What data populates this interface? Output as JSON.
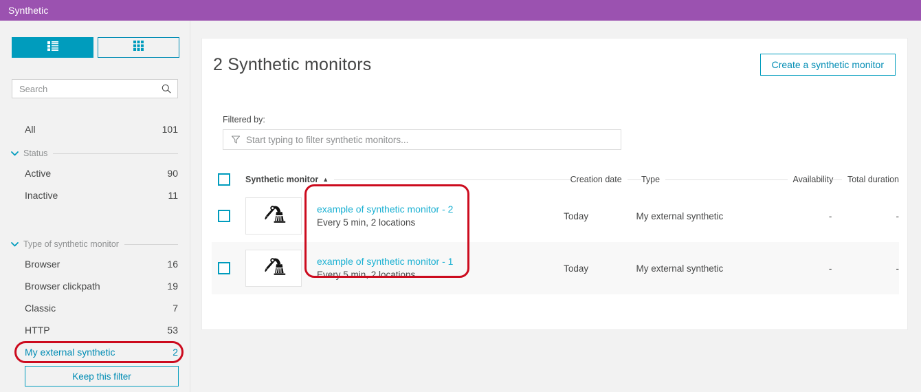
{
  "window": {
    "title": "Synthetic"
  },
  "sidebar": {
    "view_toggle": [
      {
        "name": "list-view",
        "icon": "list-icon",
        "active": true
      },
      {
        "name": "grid-view",
        "icon": "grid-icon",
        "active": false
      }
    ],
    "search": {
      "value": "",
      "placeholder": "Search",
      "icon": "search-icon"
    },
    "all": {
      "label": "All",
      "count": "101"
    },
    "groups": [
      {
        "label": "Status",
        "chevron": "chevron-down-icon",
        "items": [
          {
            "label": "Active",
            "count": "90",
            "selected": false
          },
          {
            "label": "Inactive",
            "count": "11",
            "selected": false
          }
        ]
      },
      {
        "label": "Type of synthetic monitor",
        "chevron": "chevron-down-icon",
        "items": [
          {
            "label": "Browser",
            "count": "16",
            "selected": false
          },
          {
            "label": "Browser clickpath",
            "count": "19",
            "selected": false
          },
          {
            "label": "Classic",
            "count": "7",
            "selected": false
          },
          {
            "label": "HTTP",
            "count": "53",
            "selected": false
          },
          {
            "label": "My external synthetic",
            "count": "2",
            "selected": true
          }
        ]
      }
    ],
    "keep_filter_label": "Keep this filter"
  },
  "main": {
    "page_title": "2 Synthetic monitors",
    "create_button": "Create a synthetic monitor",
    "filtered_by_label": "Filtered by:",
    "filter_input": {
      "value": "",
      "placeholder": "Start typing to filter synthetic monitors...",
      "icon": "funnel-icon"
    },
    "table": {
      "headers": {
        "monitor": "Synthetic monitor",
        "sort_indicator": "▲",
        "creation_date": "Creation date",
        "type": "Type",
        "availability": "Availability",
        "total_duration": "Total duration"
      },
      "rows": [
        {
          "name": "example of synthetic monitor - 2",
          "subtitle": "Every 5 min, 2 locations",
          "thumbnail_icon": "robot-arm-icon",
          "creation_date": "Today",
          "type": "My external synthetic",
          "availability": "-",
          "total_duration": "-"
        },
        {
          "name": "example of synthetic monitor - 1",
          "subtitle": "Every 5 min, 2 locations",
          "thumbnail_icon": "robot-arm-icon",
          "creation_date": "Today",
          "type": "My external synthetic",
          "availability": "-",
          "total_duration": "-"
        }
      ]
    }
  },
  "annotations": {
    "color": "#cc0b1e",
    "shapes": [
      {
        "name": "highlight-monitor-names",
        "shape": "rounded-rect"
      },
      {
        "name": "highlight-my-external-synthetic-filter",
        "shape": "pill"
      }
    ]
  },
  "colors": {
    "titlebar_purple": "#9b52b0",
    "accent_teal": "#009cbd",
    "link_teal": "#1ab0d2",
    "annotation_red": "#cc0b1e",
    "page_background": "#f2f2f2"
  }
}
